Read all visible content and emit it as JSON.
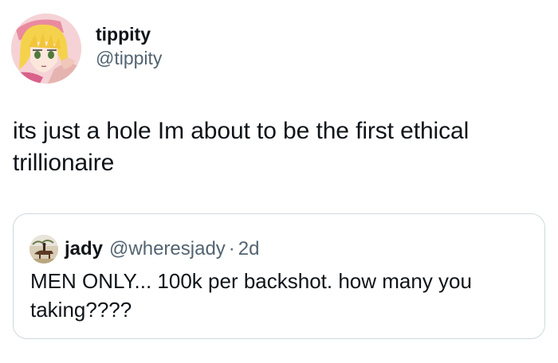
{
  "author": {
    "display_name": "tippity",
    "handle": "@tippity",
    "avatar_icon": "anime-avatar-icon"
  },
  "tweet": {
    "text": "its just a hole Im about to be the first ethical trillionaire"
  },
  "quoted_tweet": {
    "display_name": "jady",
    "handle": "@wheresjady",
    "separator": "·",
    "time": "2d",
    "text": "MEN ONLY... 100k per backshot. how many you taking????",
    "avatar_icon": "horse-rider-avatar-icon"
  },
  "colors": {
    "text": "#0f1419",
    "secondary": "#536471",
    "border": "#cfd9de"
  }
}
